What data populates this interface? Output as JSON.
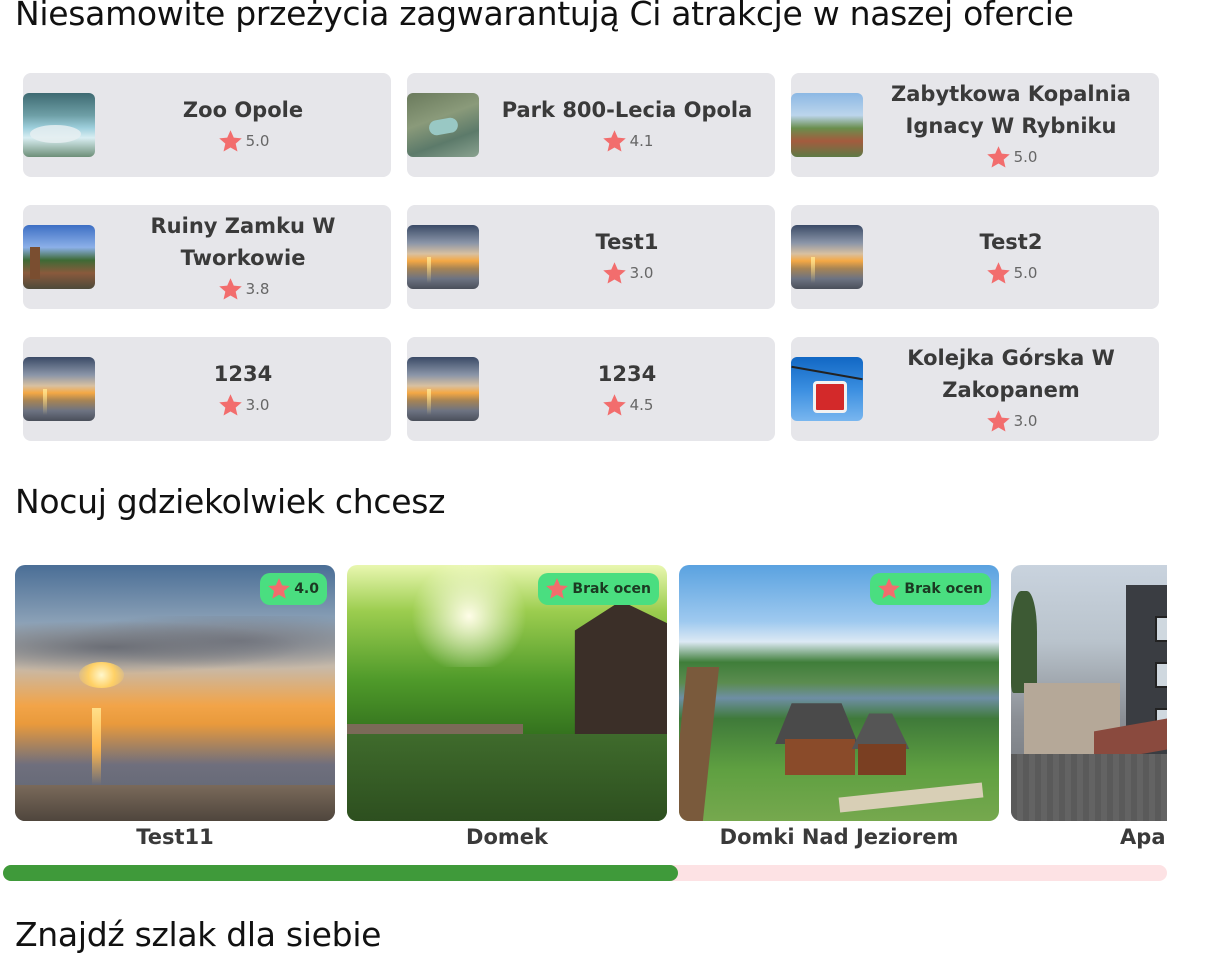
{
  "attractions": {
    "title": "Niesamowite przeżycia zagwarantują Ci atrakcje w naszej ofercie",
    "items": [
      {
        "name": "Zoo Opole",
        "rating": "5.0",
        "thumb": "zoo"
      },
      {
        "name": "Park 800-Lecia Opola",
        "rating": "4.1",
        "thumb": "park"
      },
      {
        "name": "Zabytkowa Kopalnia Ignacy W Rybniku",
        "rating": "5.0",
        "thumb": "mine"
      },
      {
        "name": "Ruiny Zamku W Tworkowie",
        "rating": "3.8",
        "thumb": "castle"
      },
      {
        "name": "Test1",
        "rating": "3.0",
        "thumb": "sunset"
      },
      {
        "name": "Test2",
        "rating": "5.0",
        "thumb": "sunset"
      },
      {
        "name": "1234",
        "rating": "3.0",
        "thumb": "sunset"
      },
      {
        "name": "1234",
        "rating": "4.5",
        "thumb": "sunset"
      },
      {
        "name": "Kolejka Górska W Zakopanem",
        "rating": "3.0",
        "thumb": "cable-car"
      }
    ]
  },
  "stays": {
    "title": "Nocuj gdziekolwiek chcesz",
    "items": [
      {
        "name": "Test11",
        "badge": "4.0",
        "image": "sea-sunset"
      },
      {
        "name": "Domek",
        "badge": "Brak ocen",
        "image": "forest-cabin"
      },
      {
        "name": "Domki Nad Jeziorem",
        "badge": "Brak ocen",
        "image": "lake-houses"
      },
      {
        "name": "Apartam",
        "badge": "",
        "image": "apartment-building"
      }
    ],
    "scroll_progress": 0.58
  },
  "trails": {
    "title": "Znajdź szlak dla siebie"
  },
  "colors": {
    "card_bg": "#e6e6ea",
    "star": "#f26d6d",
    "badge_bg": "#4ade80",
    "scroll_fill": "#3f9a3a",
    "scroll_track": "#fde2e4"
  },
  "icons": {
    "rating": "star-icon"
  }
}
